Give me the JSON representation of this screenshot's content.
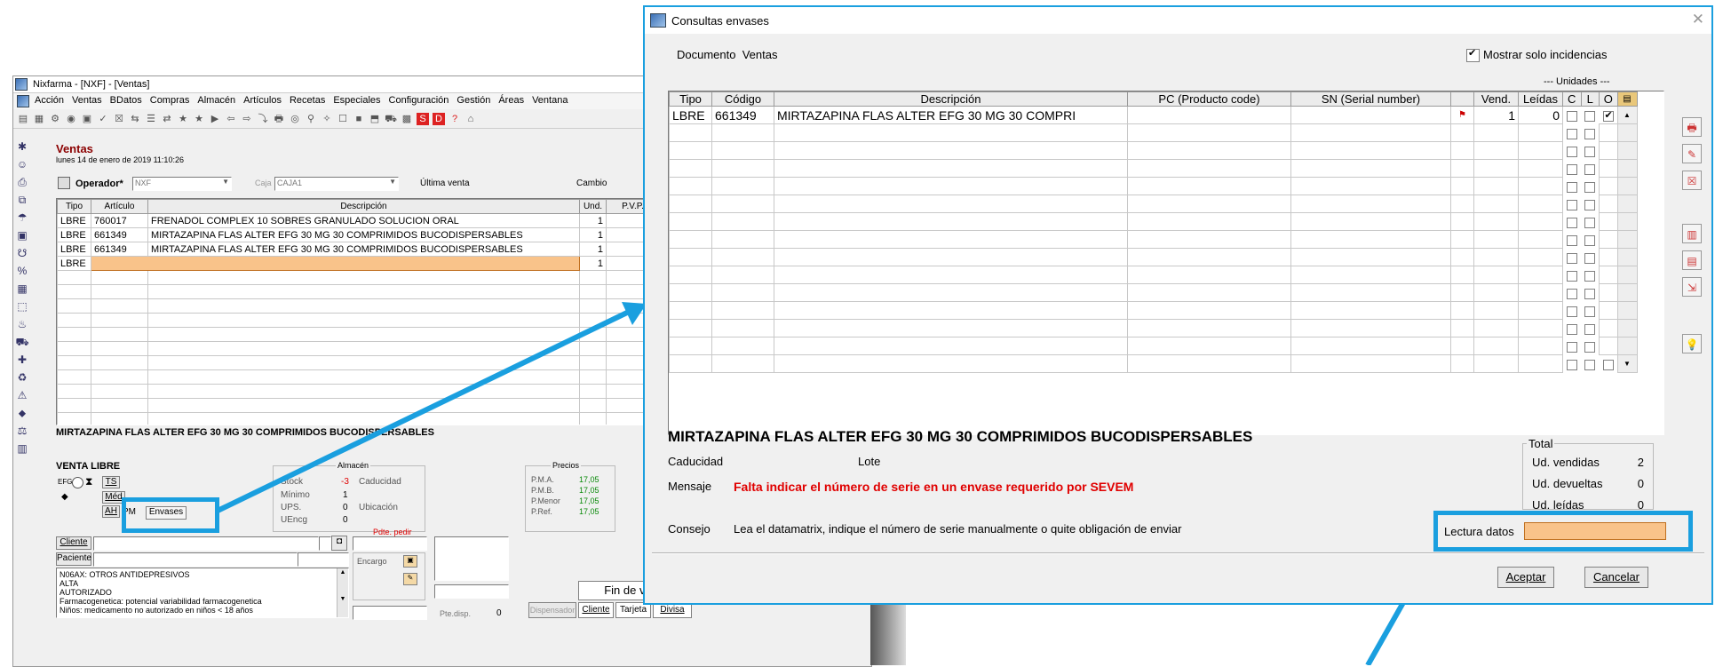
{
  "main": {
    "title": "Nixfarma - [NXF] - [Ventas]",
    "menu": [
      "Acción",
      "Ventas",
      "BDatos",
      "Compras",
      "Almacén",
      "Artículos",
      "Recetas",
      "Especiales",
      "Configuración",
      "Gestión",
      "Áreas",
      "Ventana"
    ],
    "heading": "Ventas",
    "date": "lunes 14 de enero de 2019 11:10:26",
    "operador_label": "Operador*",
    "operador_value": "NXF",
    "caja_label": "Caja",
    "caja_value": "CAJA1",
    "ultima_venta": "Última venta",
    "cambio": "Cambio",
    "columns": [
      "Tipo",
      "Artículo",
      "Descripción",
      "Und.",
      "P.V.P."
    ],
    "rows": [
      {
        "tipo": "LBRE",
        "articulo": "760017",
        "descripcion": "FRENADOL COMPLEX 10 SOBRES GRANULADO SOLUCION ORAL",
        "und": "1"
      },
      {
        "tipo": "LBRE",
        "articulo": "661349",
        "descripcion": "MIRTAZAPINA FLAS ALTER EFG 30 MG 30 COMPRIMIDOS BUCODISPERSABLES",
        "und": "1"
      },
      {
        "tipo": "LBRE",
        "articulo": "661349",
        "descripcion": "MIRTAZAPINA FLAS ALTER EFG 30 MG 30 COMPRIMIDOS BUCODISPERSABLES",
        "und": "1"
      },
      {
        "tipo": "LBRE",
        "articulo": "",
        "descripcion": "",
        "und": "1"
      }
    ],
    "product_name": "MIRTAZAPINA FLAS ALTER EFG 30 MG 30 COMPRIMIDOS BUCODISPERSABLES",
    "venta_libre": "VENTA LIBRE",
    "efg": "EFG",
    "ts": "TS",
    "med": "Méd",
    "ah": "AH",
    "pm": "PM",
    "envases": "Envases",
    "almacen": {
      "title": "Almacén",
      "stock_label": "Stock",
      "stock": "-3",
      "minimo_label": "Mínimo",
      "minimo": "1",
      "ups_label": "UPS.",
      "ups": "0",
      "uencg_label": "UEncg",
      "uencg": "0",
      "caducidad": "Caducidad",
      "ubicacion": "Ubicación",
      "pdte": "Pdte. pedir"
    },
    "precios": {
      "title": "Precios",
      "pma_label": "P.M.A.",
      "pma": "17,05",
      "pmb_label": "P.M.B.",
      "pmb": "17,05",
      "pmenor_label": "P.Menor",
      "pmenor": "17,05",
      "pref_label": "P.Ref.",
      "pref": "17,05"
    },
    "cliente": "Cliente",
    "paciente": "Paciente",
    "notes": [
      "N06AX: OTROS ANTIDEPRESIVOS",
      "ALTA",
      "AUTORIZADO",
      "Farmacogenetica: potencial variabilidad farmacogenetica",
      "Niños: medicamento no autorizado en niños < 18 años"
    ],
    "encargo": "Encargo",
    "pte_disp": "Pte.disp.",
    "pte_disp_value": "0",
    "fin_venta": "Fin de venta",
    "dispensador": "Dispensador",
    "btn_cliente": "Cliente",
    "btn_tarjeta": "Tarjeta",
    "btn_divisa": "Divisa"
  },
  "dialog": {
    "title": "Consultas envases",
    "documento": "Documento  Ventas",
    "mostrar": "Mostrar solo incidencias",
    "unidades": "--- Unidades ---",
    "columns": [
      "Tipo",
      "Código",
      "Descripción",
      "PC (Producto code)",
      "SN (Serial number)",
      "",
      "Vend.",
      "Leídas",
      "C",
      "L",
      "O"
    ],
    "row": {
      "tipo": "LBRE",
      "codigo": "661349",
      "descripcion": "MIRTAZAPINA FLAS ALTER EFG 30 MG 30 COMPRI",
      "vend": "1",
      "leidas": "0"
    },
    "product_name": "MIRTAZAPINA FLAS ALTER EFG 30 MG 30 COMPRIMIDOS BUCODISPERSABLES",
    "caducidad": "Caducidad",
    "lote": "Lote",
    "mensaje_label": "Mensaje",
    "mensaje": "Falta indicar el número de serie en un envase requerido por SEVEM",
    "consejo_label": "Consejo",
    "consejo": "Lea el datamatrix, indique el número de serie manualmente o quite obligación de enviar",
    "total_title": "Total",
    "ud_vendidas_label": "Ud. vendidas",
    "ud_vendidas": "2",
    "ud_devueltas_label": "Ud. devueltas",
    "ud_devueltas": "0",
    "ud_leidas_label": "Ud. leídas",
    "ud_leidas": "0",
    "lectura_label": "Lectura datos",
    "aceptar": "Aceptar",
    "cancelar": "Cancelar"
  },
  "colors": {
    "highlight": "#1a9fdf",
    "input_orange": "#f9c38a",
    "heading_red": "#8b0000",
    "message_red": "#e00000"
  }
}
